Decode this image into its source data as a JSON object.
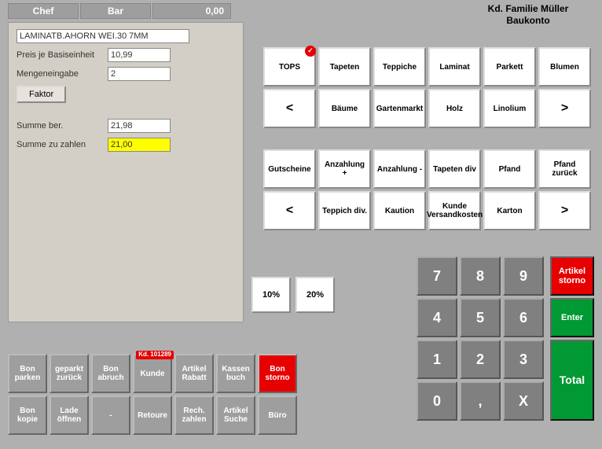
{
  "tabs": {
    "chef": "Chef",
    "bar": "Bar",
    "total": "0,00"
  },
  "panel": {
    "article": "LAMINATB.AHORN WEI.30 7MM",
    "price_label": "Preis je Basiseinheit",
    "price": "10,99",
    "qty_label": "Mengeneingabe",
    "qty": "2",
    "factor_btn": "Faktor",
    "sum_calc_label": "Summe ber.",
    "sum_calc": "21,98",
    "sum_pay_label": "Summe zu zahlen",
    "sum_pay": "21,00"
  },
  "customer": {
    "line1": "Kd. Familie Müller",
    "line2": "Baukonto"
  },
  "cats1": [
    "TOPS",
    "Tapeten",
    "Teppiche",
    "Laminat",
    "Parkett",
    "Blumen",
    "<",
    "Bäume",
    "Gartenmarkt",
    "Holz",
    "Linolium",
    ">"
  ],
  "cats2": [
    "Gutscheine",
    "Anzahlung +",
    "Anzahlung -",
    "Tapeten div",
    "Pfand",
    "Pfand zurück",
    "<",
    "Teppich div.",
    "Kaution",
    "Kunde Versandkosten",
    "Karton",
    ">"
  ],
  "discounts": [
    "10%",
    "20%"
  ],
  "numpad": [
    "7",
    "8",
    "9",
    "4",
    "5",
    "6",
    "1",
    "2",
    "3",
    "0",
    ",",
    "X"
  ],
  "actions": {
    "storno": "Artikel storno",
    "enter": "Enter",
    "total": "Total"
  },
  "funcs": {
    "row1": [
      "Bon parken",
      "geparkt zurück",
      "Bon abruch",
      "Kunde",
      "Artikel Rabatt",
      "Kassen buch",
      "Bon storno"
    ],
    "row2": [
      "Bon kopie",
      "Lade öffnen",
      "-",
      "Retoure",
      "Rech. zahlen",
      "Artikel Suche",
      "Büro"
    ],
    "kd_badge": "Kd. 101289"
  }
}
